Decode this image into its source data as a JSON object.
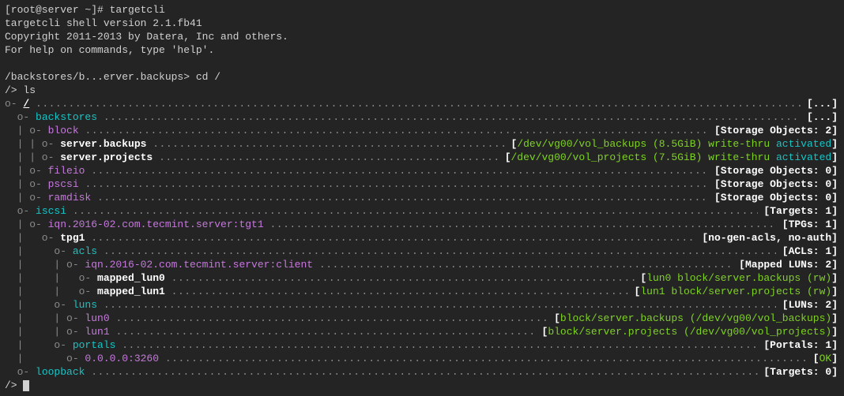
{
  "header": {
    "prompt": "[root@server ~]# ",
    "cmd": "targetcli",
    "version": "targetcli shell version 2.1.fb41",
    "copyright": "Copyright 2011-2013 by Datera, Inc and others.",
    "help": "For help on commands, type 'help'."
  },
  "nav": {
    "path_prompt": "/backstores/b...erver.backups> ",
    "cd_cmd": "cd /",
    "ls_prompt": "/> ",
    "ls_cmd": "ls"
  },
  "tree": {
    "root_label": "/",
    "root_info": "[...]",
    "backstores": {
      "label": "backstores",
      "info": "[...]",
      "block": {
        "label": "block",
        "info_pre": "[Storage Objects: 2]",
        "backups": {
          "label": "server.backups",
          "dev": "/dev/vg00/vol_backups (8.5GiB) write-thru ",
          "state": "activated"
        },
        "projects": {
          "label": "server.projects",
          "dev": "/dev/vg00/vol_projects (7.5GiB) write-thru ",
          "state": "activated"
        }
      },
      "fileio": {
        "label": "fileio",
        "info": "[Storage Objects: 0]"
      },
      "pscsi": {
        "label": "pscsi",
        "info": "[Storage Objects: 0]"
      },
      "ramdisk": {
        "label": "ramdisk",
        "info": "[Storage Objects: 0]"
      }
    },
    "iscsi": {
      "label": "iscsi",
      "info": "[Targets: 1]",
      "target": {
        "label": "iqn.2016-02.com.tecmint.server:tgt1",
        "info": "[TPGs: 1]",
        "tpg": {
          "label": "tpg1",
          "info": "[no-gen-acls, no-auth]",
          "acls": {
            "label": "acls",
            "info": "[ACLs: 1]",
            "client": {
              "label": "iqn.2016-02.com.tecmint.server:client",
              "info": "[Mapped LUNs: 2]",
              "ml0": {
                "label": "mapped_lun0",
                "map": "lun0 block/server.backups (rw)"
              },
              "ml1": {
                "label": "mapped_lun1",
                "map": "lun1 block/server.projects (rw)"
              }
            }
          },
          "luns": {
            "label": "luns",
            "info": "[LUNs: 2]",
            "l0": {
              "label": "lun0",
              "map": "block/server.backups (/dev/vg00/vol_backups)"
            },
            "l1": {
              "label": "lun1",
              "map": "block/server.projects (/dev/vg00/vol_projects)"
            }
          },
          "portals": {
            "label": "portals",
            "info": "[Portals: 1]",
            "p0": {
              "label": "0.0.0.0:3260",
              "status": "OK"
            }
          }
        }
      }
    },
    "loopback": {
      "label": "loopback",
      "info": "[Targets: 0]"
    }
  },
  "tail": {
    "prompt": "/> "
  }
}
